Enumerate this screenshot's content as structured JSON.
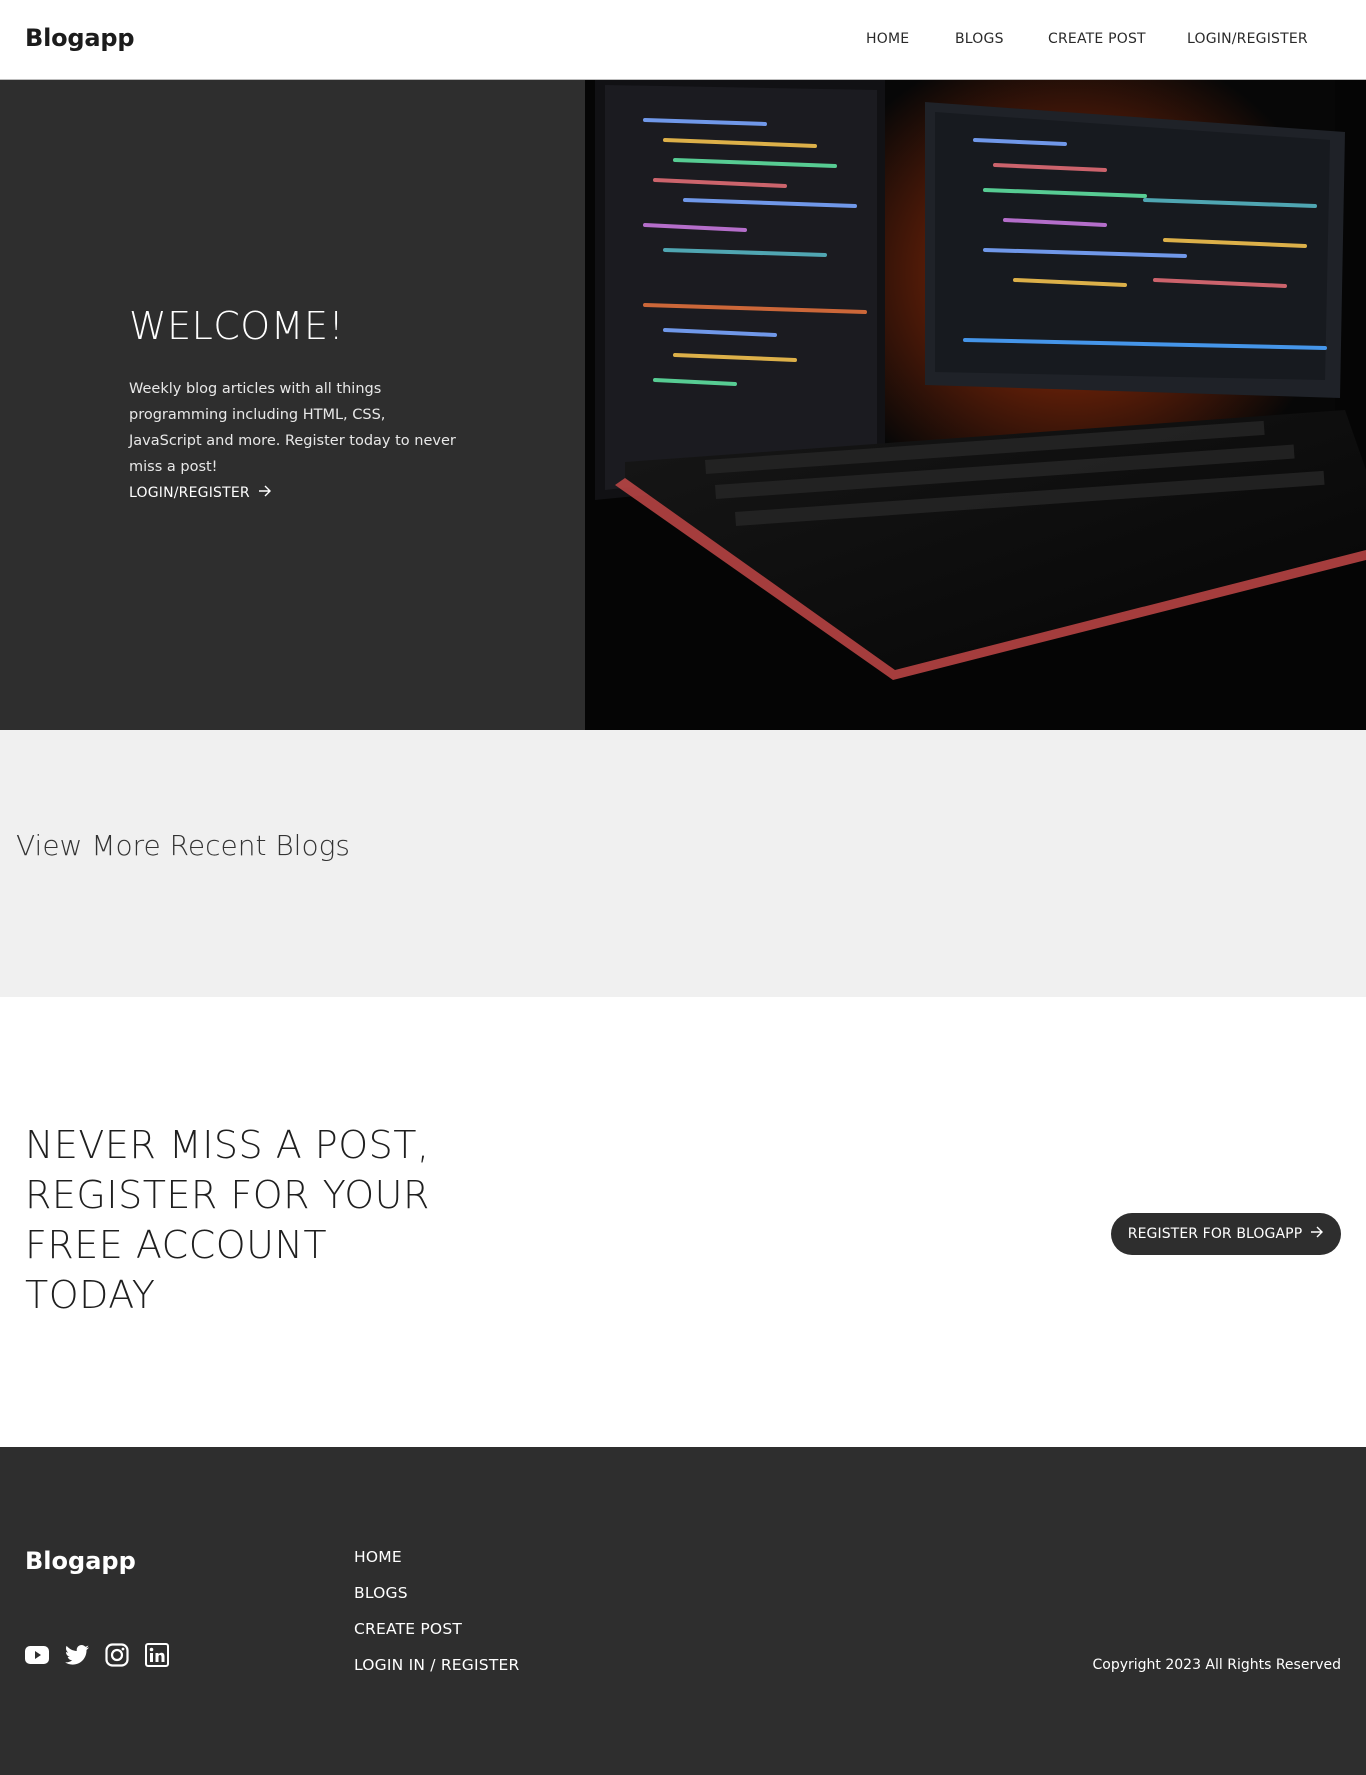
{
  "header": {
    "brand": "Blogapp",
    "nav": [
      "HOME",
      "BLOGS",
      "CREATE POST",
      "LOGIN/REGISTER"
    ]
  },
  "hero": {
    "title": "WELCOME!",
    "text": "Weekly blog articles with all things programming including HTML, CSS, JavaScript and more. Register today to never miss a post!",
    "link_label": "LOGIN/REGISTER",
    "image_icon": "desktop-monitors-keyboard-photo"
  },
  "recent": {
    "title": "View More Recent Blogs"
  },
  "cta": {
    "title": "NEVER MISS A POST, REGISTER FOR YOUR FREE ACCOUNT TODAY",
    "button_label": "REGISTER FOR BLOGAPP"
  },
  "footer": {
    "brand": "Blogapp",
    "social_icons": [
      "youtube-icon",
      "twitter-icon",
      "instagram-icon",
      "linkedin-icon"
    ],
    "nav": [
      "HOME",
      "BLOGS",
      "CREATE POST",
      "LOGIN IN / REGISTER"
    ],
    "copyright": "Copyright 2023 All Rights Reserved"
  },
  "colors": {
    "dark": "#2e2e2e",
    "light_gray": "#f0f0f0",
    "white": "#ffffff"
  }
}
